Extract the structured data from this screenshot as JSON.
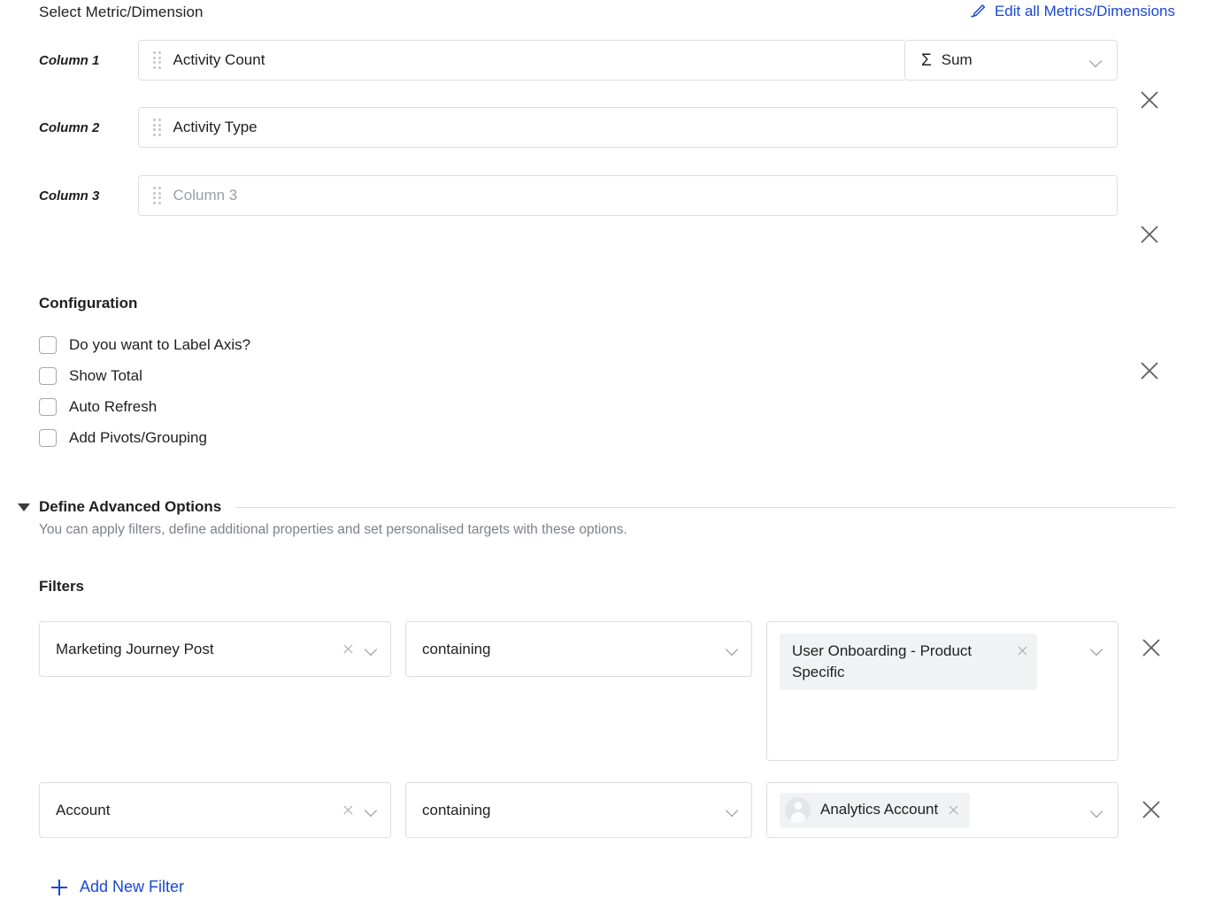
{
  "metric_section": {
    "title": "Select Metric/Dimension",
    "edit_all_label": "Edit all Metrics/Dimensions",
    "edit_icon": "pencil-icon",
    "accent_color": "#1a47d6",
    "columns": [
      {
        "label": "Column 1",
        "value": "Activity Count",
        "is_placeholder": false,
        "has_aggregation": true,
        "aggregation": "Sum",
        "aggregation_symbol": "Σ"
      },
      {
        "label": "Column 2",
        "value": "Activity Type",
        "is_placeholder": false,
        "has_aggregation": false
      },
      {
        "label": "Column 3",
        "value": "Column 3",
        "is_placeholder": true,
        "has_aggregation": false
      }
    ]
  },
  "configuration": {
    "title": "Configuration",
    "options": [
      {
        "label": "Do you want to Label Axis?",
        "checked": false
      },
      {
        "label": "Show Total",
        "checked": false
      },
      {
        "label": "Auto Refresh",
        "checked": false
      },
      {
        "label": "Add Pivots/Grouping",
        "checked": false
      }
    ]
  },
  "advanced": {
    "title": "Define Advanced Options",
    "expanded": true,
    "description": "You can apply filters, define additional properties and set personalised targets with these options."
  },
  "filters": {
    "title": "Filters",
    "add_new_label": "Add New Filter",
    "rows": [
      {
        "dimension": "Marketing Journey Post",
        "operator": "containing",
        "value_chips": [
          {
            "text": "User Onboarding - Product Specific",
            "has_avatar": false
          }
        ],
        "tall_value_box": true
      },
      {
        "dimension": "Account",
        "operator": "containing",
        "value_chips": [
          {
            "text": "Analytics Account",
            "has_avatar": true
          }
        ],
        "tall_value_box": false
      }
    ]
  }
}
